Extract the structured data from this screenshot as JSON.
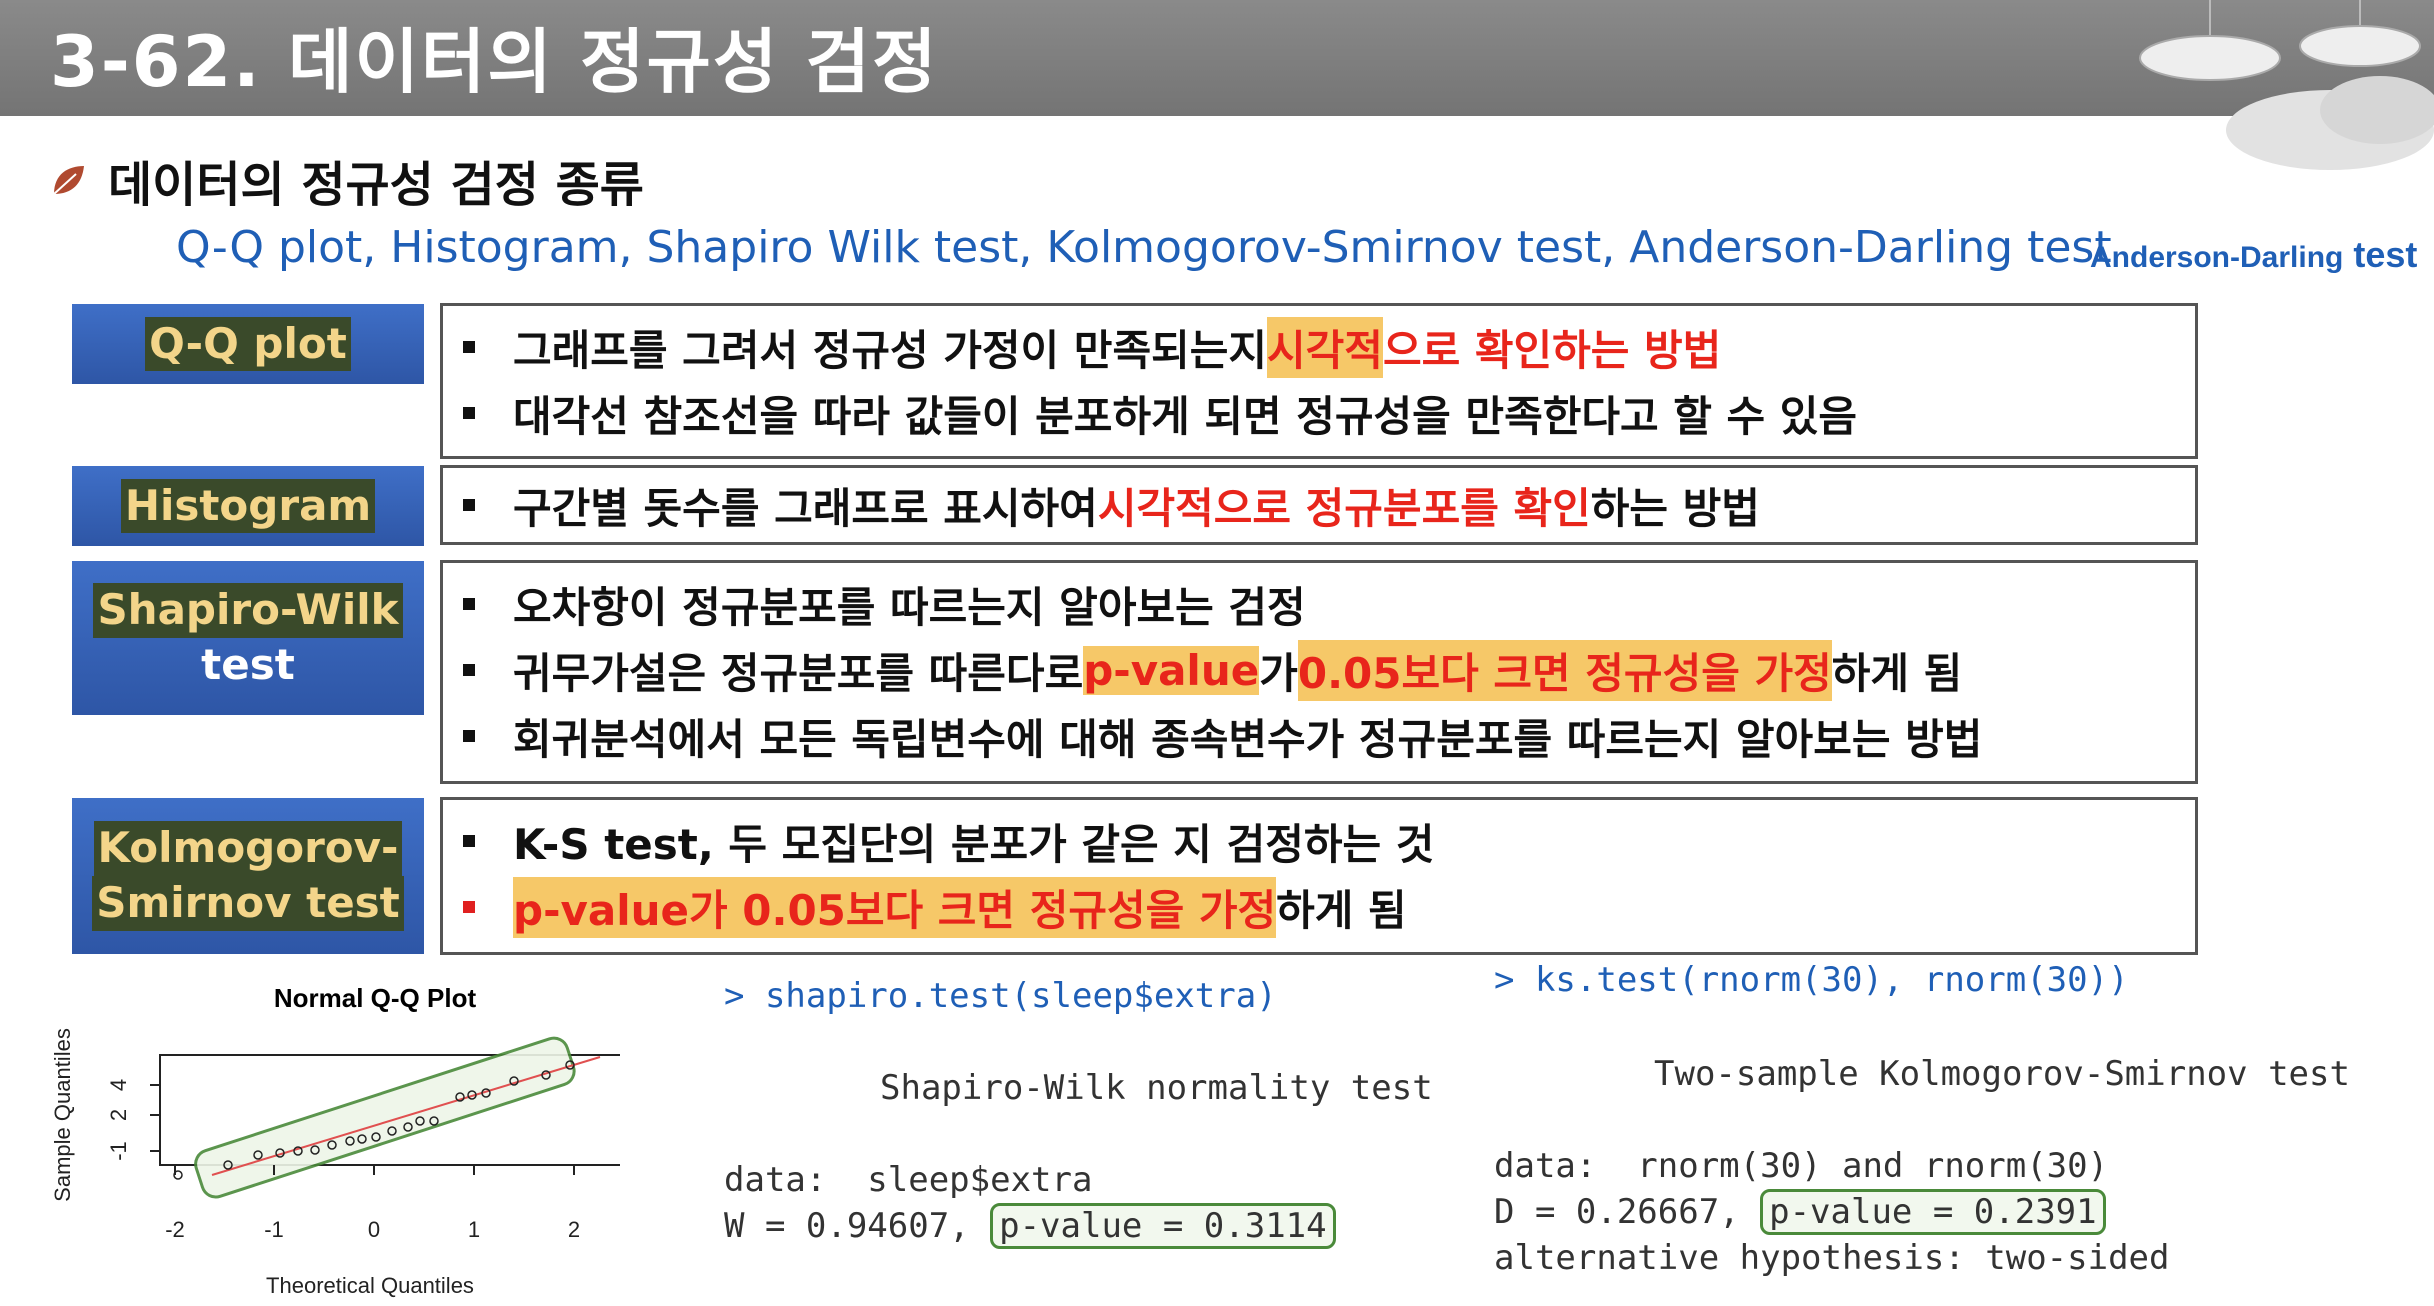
{
  "title": "3-62. 데이터의 정규성 검정",
  "section_title": "데이터의 정규성 검정 종류",
  "subtitle": "Q-Q plot, Histogram, Shapiro Wilk test, Kolmogorov-Smirnov test, Anderson-Darling test",
  "subtitle_small_a": "Anderson-Darling",
  "subtitle_small_b": " test",
  "rows": [
    {
      "label": "Q-Q plot",
      "b1": [
        "그래프를 그려서 정규성 가정이 만족되는지 ",
        "시각적",
        "으로 확인하는 방법"
      ],
      "b2": "대각선 참조선을 따라 값들이 분포하게 되면 정규성을 만족한다고 할 수 있음"
    },
    {
      "label": "Histogram",
      "b1": [
        "구간별 돗수를 그래프로 표시하여 ",
        "시각적으로 정규분포를 확인",
        "하는 방법"
      ]
    },
    {
      "label1": "Shapiro-Wilk",
      "label2": "test",
      "b1": "오차항이 정규분포를 따르는지 알아보는 검정",
      "b2": [
        "귀무가설은 정규분포를 따른다로 ",
        "p-value",
        "가 ",
        "0.05보다 크면 정규성을 가정",
        "하게 됨"
      ],
      "b3": "회귀분석에서 모든 독립변수에 대해 종속변수가 정규분포를 따르는지 알아보는 방법"
    },
    {
      "label1": "Kolmogorov-",
      "label2": "Smirnov test",
      "b1": "K-S test, 두 모집단의 분포가 같은 지 검정하는 것",
      "b2": [
        "p-value가 0.05보다 크면 정규성을 가정",
        "하게 됨"
      ]
    }
  ],
  "qq_plot": {
    "title": "Normal Q-Q Plot",
    "xlabel": "Theoretical Quantiles",
    "ylabel": "Sample Quantiles",
    "xticks": [
      "-2",
      "-1",
      "0",
      "1",
      "2"
    ],
    "yticks": [
      "-1",
      "2",
      "4"
    ]
  },
  "shapiro": {
    "cmd": "> shapiro.test(sleep$extra)",
    "heading": "Shapiro-Wilk normality test",
    "data_line": "data:  sleep$extra",
    "stat": "W = 0.94607, ",
    "pvalue": "p-value = 0.3114"
  },
  "ks": {
    "cmd": "> ks.test(rnorm(30), rnorm(30))",
    "heading": "Two-sample Kolmogorov-Smirnov test",
    "data_line": "data:  rnorm(30) and rnorm(30)",
    "stat": "D = 0.26667, ",
    "pvalue": "p-value = 0.2391",
    "alt": "alternative hypothesis: two-sided"
  }
}
